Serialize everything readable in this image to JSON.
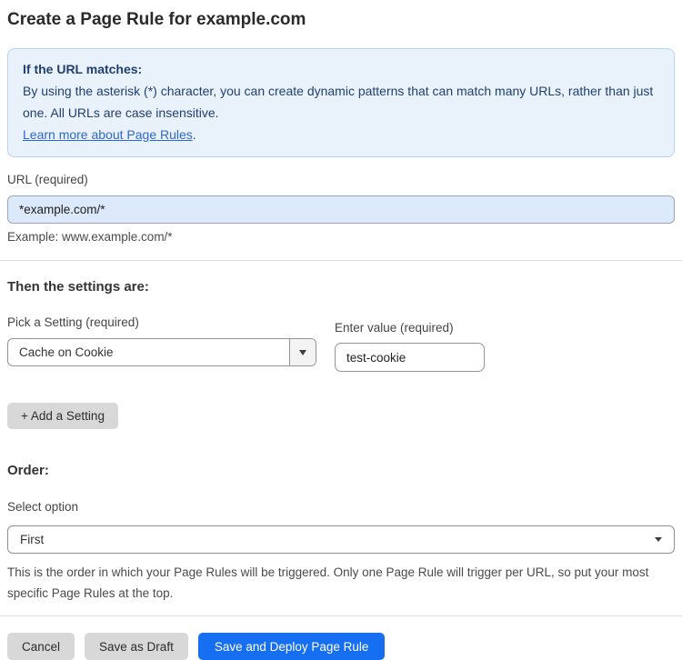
{
  "page": {
    "title": "Create a Page Rule for example.com"
  },
  "info_box": {
    "heading": "If the URL matches:",
    "body": "By using the asterisk (*) character, you can create dynamic patterns that can match many URLs, rather than just one. All URLs are case insensitive.",
    "link_label": "Learn more about Page Rules",
    "link_suffix": "."
  },
  "url_field": {
    "label": "URL (required)",
    "value": "*example.com/*",
    "example": "Example: www.example.com/*"
  },
  "settings": {
    "heading": "Then the settings are:",
    "setting_select": {
      "label": "Pick a Setting (required)",
      "value": "Cache on Cookie"
    },
    "value_field": {
      "label": "Enter value (required)",
      "value": "test-cookie"
    },
    "add_button_label": "+ Add a Setting"
  },
  "order": {
    "heading": "Order:",
    "select_label": "Select option",
    "value": "First",
    "help": "This is the order in which your Page Rules will be triggered. Only one Page Rule will trigger per URL, so put your most specific Page Rules at the top."
  },
  "footer": {
    "cancel_label": "Cancel",
    "save_draft_label": "Save as Draft",
    "save_deploy_label": "Save and Deploy Page Rule"
  },
  "colors": {
    "info_box_bg": "#e9f2fb",
    "info_box_border": "#b7d4ee",
    "info_text": "#21406f",
    "link_blue": "#2e67d1",
    "url_input_bg": "#dce9fa",
    "primary_button_blue": "#166ff0",
    "gray_button": "#d8d8d8"
  }
}
